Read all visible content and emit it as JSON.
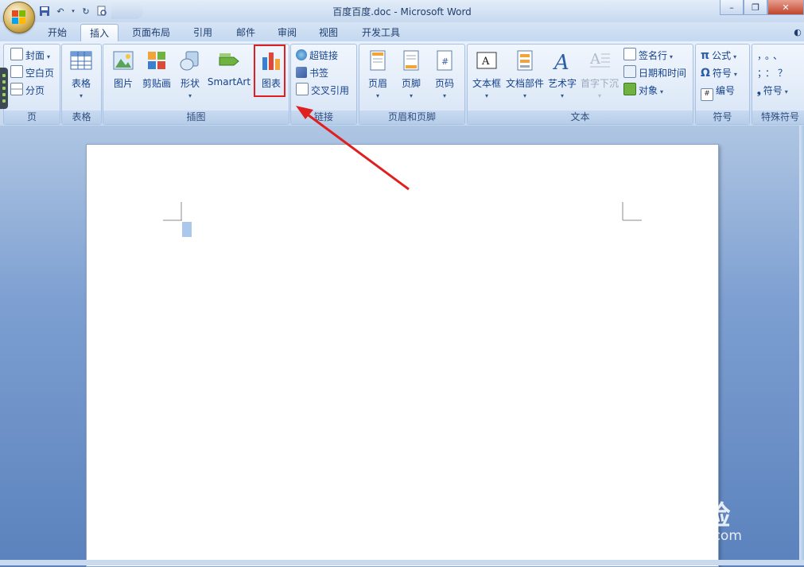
{
  "window": {
    "title": "百度百度.doc - Microsoft Word"
  },
  "tabs": [
    {
      "label": "开始",
      "active": false
    },
    {
      "label": "插入",
      "active": true
    },
    {
      "label": "页面布局",
      "active": false
    },
    {
      "label": "引用",
      "active": false
    },
    {
      "label": "邮件",
      "active": false
    },
    {
      "label": "审阅",
      "active": false
    },
    {
      "label": "视图",
      "active": false
    },
    {
      "label": "开发工具",
      "active": false
    }
  ],
  "groups": {
    "page": {
      "label": "页",
      "items": [
        "封面",
        "空白页",
        "分页"
      ]
    },
    "table": {
      "label": "表格",
      "items": [
        "表格"
      ]
    },
    "illustrations": {
      "label": "插图",
      "items": [
        "图片",
        "剪贴画",
        "形状",
        "SmartArt",
        "图表"
      ]
    },
    "links": {
      "label": "链接",
      "items": [
        "超链接",
        "书签",
        "交叉引用"
      ]
    },
    "header_footer": {
      "label": "页眉和页脚",
      "items": [
        "页眉",
        "页脚",
        "页码"
      ]
    },
    "text": {
      "label": "文本",
      "items": [
        "文本框",
        "文档部件",
        "艺术字",
        "首字下沉"
      ],
      "small": [
        "签名行",
        "日期和时间",
        "对象"
      ]
    },
    "symbols": {
      "label": "符号",
      "items": [
        "公式",
        "符号",
        "编号"
      ]
    },
    "special": {
      "label": "特殊符号",
      "items": [
        "符号"
      ],
      "chars": [
        "，",
        "。",
        "、",
        "；",
        "：",
        "？"
      ]
    }
  },
  "watermark": {
    "brand": "Bai  经验",
    "url": "jingyan.baidu.com"
  },
  "colors": {
    "accent": "#15428b",
    "highlight": "#e02020",
    "arrow": "#e02020"
  }
}
